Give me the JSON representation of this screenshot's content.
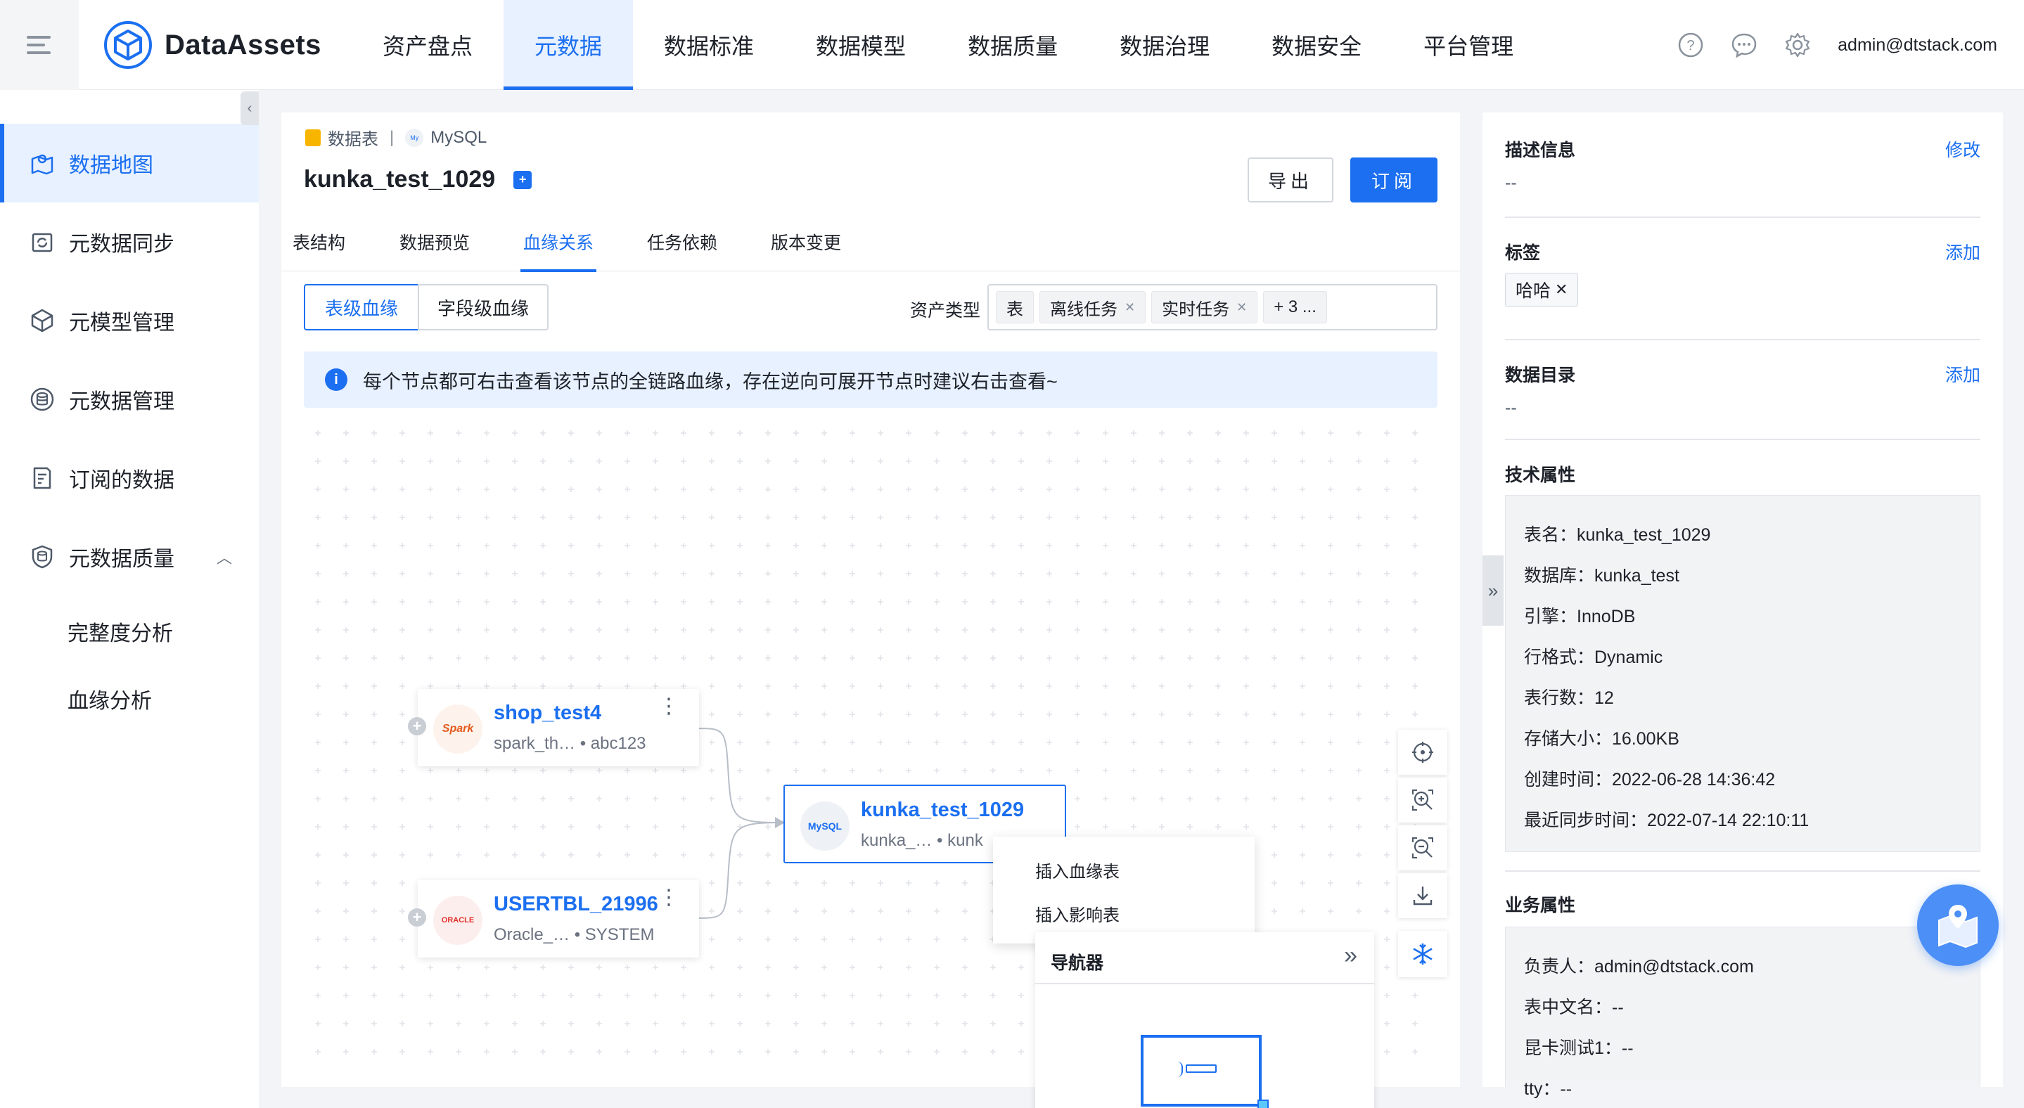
{
  "header": {
    "logo_text": "DataAssets",
    "nav": [
      "资产盘点",
      "元数据",
      "数据标准",
      "数据模型",
      "数据质量",
      "数据治理",
      "数据安全",
      "平台管理"
    ],
    "active_nav": "元数据",
    "user": "admin@dtstack.com",
    "icons": [
      "help-icon",
      "message-icon",
      "settings-icon"
    ]
  },
  "sidebar": {
    "items": [
      {
        "label": "数据地图",
        "icon": "map-icon",
        "active": true
      },
      {
        "label": "元数据同步",
        "icon": "sync-icon"
      },
      {
        "label": "元模型管理",
        "icon": "cube-icon"
      },
      {
        "label": "元数据管理",
        "icon": "database-icon"
      },
      {
        "label": "订阅的数据",
        "icon": "subscribe-icon"
      },
      {
        "label": "元数据质量",
        "icon": "quality-icon",
        "expanded": true
      }
    ],
    "sub_items": [
      "完整度分析",
      "血缘分析"
    ]
  },
  "main": {
    "breadcrumb": {
      "type": "数据表",
      "source": "MySQL"
    },
    "title": "kunka_test_1029",
    "export_label": "导出",
    "subscribe_label": "订阅",
    "tabs": [
      "表结构",
      "数据预览",
      "血缘关系",
      "任务依赖",
      "版本变更"
    ],
    "active_tab": "血缘关系",
    "lineage_toggle": [
      "表级血缘",
      "字段级血缘"
    ],
    "asset_type_label": "资产类型",
    "asset_chips": [
      "表",
      "离线任务",
      "实时任务",
      "+ 3 ..."
    ],
    "info_text": "每个节点都可右击查看该节点的全链路血缘，存在逆向可展开节点时建议右击查看~",
    "nodes": [
      {
        "name": "shop_test4",
        "icon_text": "Spark",
        "sub": "spark_th…  • abc123"
      },
      {
        "name": "USERTBL_21996",
        "icon_text": "ORACLE",
        "sub": "Oracle_…  • SYSTEM"
      },
      {
        "name": "kunka_test_1029",
        "icon_text": "MySQL",
        "sub": "kunka_…   • kunk"
      }
    ],
    "context_menu": [
      "插入血缘表",
      "插入影响表"
    ],
    "navigator_title": "导航器"
  },
  "right": {
    "desc": {
      "title": "描述信息",
      "action": "修改",
      "value": "--"
    },
    "tags": {
      "title": "标签",
      "action": "添加",
      "chip": "哈哈"
    },
    "catalog": {
      "title": "数据目录",
      "action": "添加",
      "value": "--"
    },
    "tech": {
      "title": "技术属性",
      "lines": [
        "表名：kunka_test_1029",
        "数据库：kunka_test",
        "引擎：InnoDB",
        "行格式：Dynamic",
        "表行数：12",
        "存储大小：16.00KB",
        "创建时间：2022-06-28 14:36:42",
        "最近同步时间：2022-07-14 22:10:11"
      ]
    },
    "biz": {
      "title": "业务属性",
      "lines": [
        "负责人：admin@dtstack.com",
        "表中文名：--",
        "昆卡测试1：--",
        "tty：--"
      ]
    }
  },
  "colors": {
    "accent": "#1b6ff0",
    "accent_bg": "#e8f1ff"
  }
}
